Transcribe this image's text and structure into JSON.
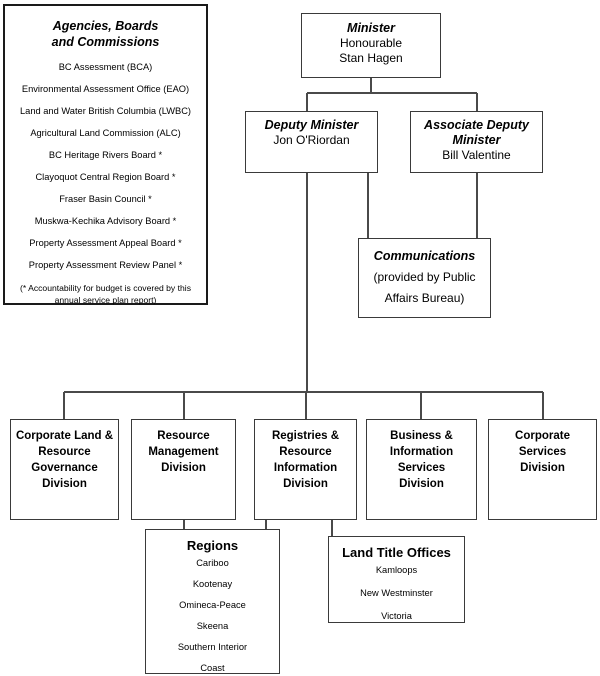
{
  "agencies_panel": {
    "title_line1": "Agencies, Boards",
    "title_line2": "and Commissions",
    "items": [
      "BC Assessment (BCA)",
      "Environmental Assessment Office (EAO)",
      "Land and Water British Columbia (LWBC)",
      "Agricultural Land Commission (ALC)",
      "BC Heritage Rivers Board *",
      "Clayoquot Central Region Board *",
      "Fraser Basin Council *",
      "Muskwa-Kechika Advisory Board *",
      "Property Assessment Appeal Board *",
      "Property Assessment Review Panel *"
    ],
    "note": "(* Accountability for budget is covered by this annual service plan report)"
  },
  "minister": {
    "title": "Minister",
    "name_line1": "Honourable",
    "name_line2": "Stan Hagen"
  },
  "deputy_minister": {
    "title": "Deputy Minister",
    "name": "Jon O'Riordan"
  },
  "associate_deputy_minister": {
    "title_line1": "Associate Deputy",
    "title_line2": "Minister",
    "name": "Bill Valentine"
  },
  "communications": {
    "title": "Communications",
    "note_line1": "(provided by Public",
    "note_line2": "Affairs Bureau)"
  },
  "divisions": [
    {
      "line1": "Corporate Land &",
      "line2": "Resource",
      "line3": "Governance",
      "line4": "Division"
    },
    {
      "line1": "Resource",
      "line2": "Management",
      "line3": "Division",
      "line4": ""
    },
    {
      "line1": "Registries &",
      "line2": "Resource",
      "line3": "Information",
      "line4": "Division"
    },
    {
      "line1": "Business &",
      "line2": "Information",
      "line3": "Services",
      "line4": "Division"
    },
    {
      "line1": "Corporate",
      "line2": "Services",
      "line3": "Division",
      "line4": ""
    }
  ],
  "regions": {
    "title": "Regions",
    "items": [
      "Cariboo",
      "Kootenay",
      "Omineca-Peace",
      "Skeena",
      "Southern Interior",
      "Coast"
    ]
  },
  "land_title_offices": {
    "title": "Land Title Offices",
    "items": [
      "Kamloops",
      "New Westminster",
      "Victoria"
    ]
  },
  "style": {
    "line_color": "#4a4a4a",
    "border_color": "#3a3a3a",
    "panel_border_color": "#1a1a1a",
    "background": "#ffffff",
    "text_color": "#000000"
  }
}
